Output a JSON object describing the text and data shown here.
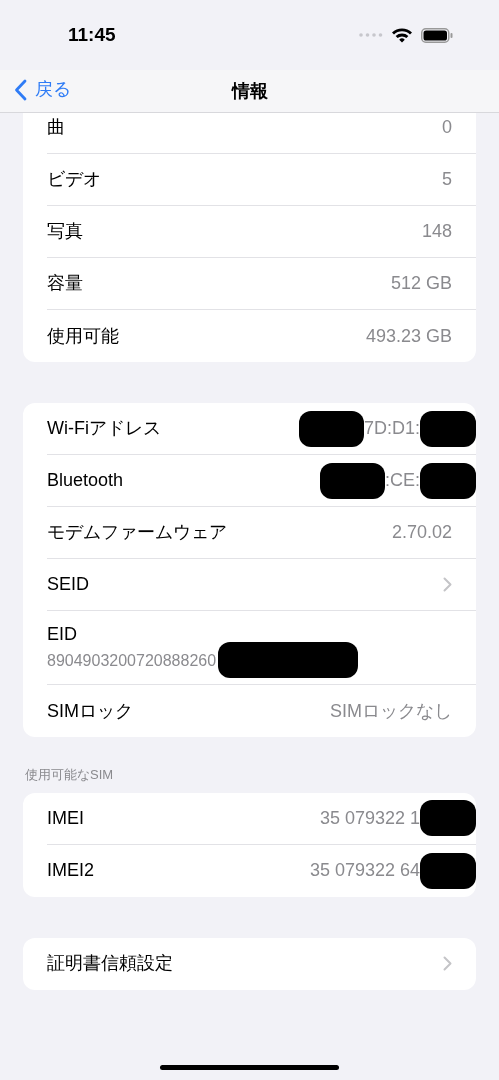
{
  "status_bar": {
    "time": "11:45"
  },
  "nav": {
    "back": "戻る",
    "title": "情報"
  },
  "sections": [
    {
      "rows": [
        {
          "kind": "value",
          "label": "曲",
          "value": "0"
        },
        {
          "kind": "value",
          "label": "ビデオ",
          "value": "5"
        },
        {
          "kind": "value",
          "label": "写真",
          "value": "148"
        },
        {
          "kind": "value",
          "label": "容量",
          "value": "512 GB"
        },
        {
          "kind": "value",
          "label": "使用可能",
          "value": "493.23 GB"
        }
      ]
    },
    {
      "rows": [
        {
          "kind": "value",
          "label": "Wi-Fiアドレス",
          "value": "7D:D1:",
          "redacted_before": true,
          "redacted_after": true
        },
        {
          "kind": "value",
          "label": "Bluetooth",
          "value": ":CE:",
          "redacted_before": true,
          "redacted_after": true
        },
        {
          "kind": "value",
          "label": "モデムファームウェア",
          "value": "2.70.02"
        },
        {
          "kind": "link",
          "label": "SEID"
        },
        {
          "kind": "stacked",
          "label": "EID",
          "value": "8904903200720888260",
          "redacted_after": true
        },
        {
          "kind": "value",
          "label": "SIMロック",
          "value": "SIMロックなし"
        }
      ]
    },
    {
      "header": "使用可能なSIM",
      "rows": [
        {
          "kind": "value",
          "label": "IMEI",
          "value": "35 079322 1",
          "redacted_after": true
        },
        {
          "kind": "value",
          "label": "IMEI2",
          "value": "35 079322 64",
          "redacted_after": true
        }
      ]
    },
    {
      "rows": [
        {
          "kind": "link",
          "label": "証明書信頼設定"
        }
      ]
    }
  ]
}
